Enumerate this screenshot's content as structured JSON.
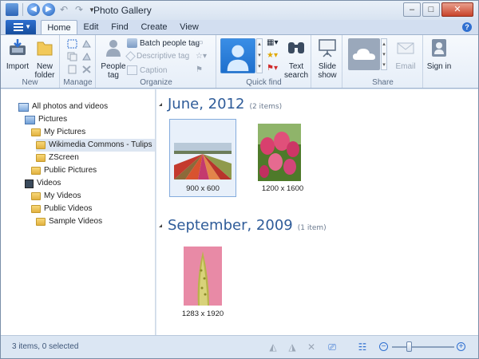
{
  "window": {
    "title": "Photo Gallery"
  },
  "ribbon_tabs": [
    {
      "label": "Home",
      "active": true
    },
    {
      "label": "Edit"
    },
    {
      "label": "Find"
    },
    {
      "label": "Create"
    },
    {
      "label": "View"
    }
  ],
  "ribbon": {
    "new_group": {
      "label": "New",
      "import": "Import",
      "new_folder": "New folder"
    },
    "manage_group": {
      "label": "Manage"
    },
    "organize_group": {
      "label": "Organize",
      "people_tag": "People tag",
      "batch_people_tag": "Batch people tag",
      "descriptive_tag": "Descriptive tag",
      "caption": "Caption"
    },
    "quickfind_group": {
      "label": "Quick find",
      "text_search": "Text search"
    },
    "slideshow": "Slide show",
    "share_group": {
      "label": "Share",
      "email": "Email"
    },
    "sign_in": "Sign in"
  },
  "nav_tree": [
    {
      "label": "All photos and videos",
      "icon": "all-media-icon",
      "level": 0
    },
    {
      "label": "Pictures",
      "icon": "library-icon",
      "level": 1
    },
    {
      "label": "My Pictures",
      "icon": "folder-icon",
      "level": 2
    },
    {
      "label": "Wikimedia Commons - Tulips",
      "icon": "folder-icon",
      "level": 3,
      "selected": true
    },
    {
      "label": "ZScreen",
      "icon": "folder-icon",
      "level": 3
    },
    {
      "label": "Public Pictures",
      "icon": "folder-icon",
      "level": 2
    },
    {
      "label": "Videos",
      "icon": "video-library-icon",
      "level": 1
    },
    {
      "label": "My Videos",
      "icon": "folder-icon",
      "level": 2
    },
    {
      "label": "Public Videos",
      "icon": "folder-icon",
      "level": 2
    },
    {
      "label": "Sample Videos",
      "icon": "folder-icon",
      "level": 3
    }
  ],
  "groups": [
    {
      "title": "June, 2012",
      "count": "(2 items)",
      "items": [
        {
          "size": "900 x 600",
          "selected": true,
          "image": "tulip-field"
        },
        {
          "size": "1200 x 1600",
          "image": "pink-tulips"
        }
      ]
    },
    {
      "title": "September, 2009",
      "count": "(1 item)",
      "items": [
        {
          "size": "1283 x 1920",
          "image": "tulip-closeup"
        }
      ]
    }
  ],
  "status": {
    "text": "3 items, 0 selected"
  },
  "zoom": {
    "level": 0.27
  }
}
